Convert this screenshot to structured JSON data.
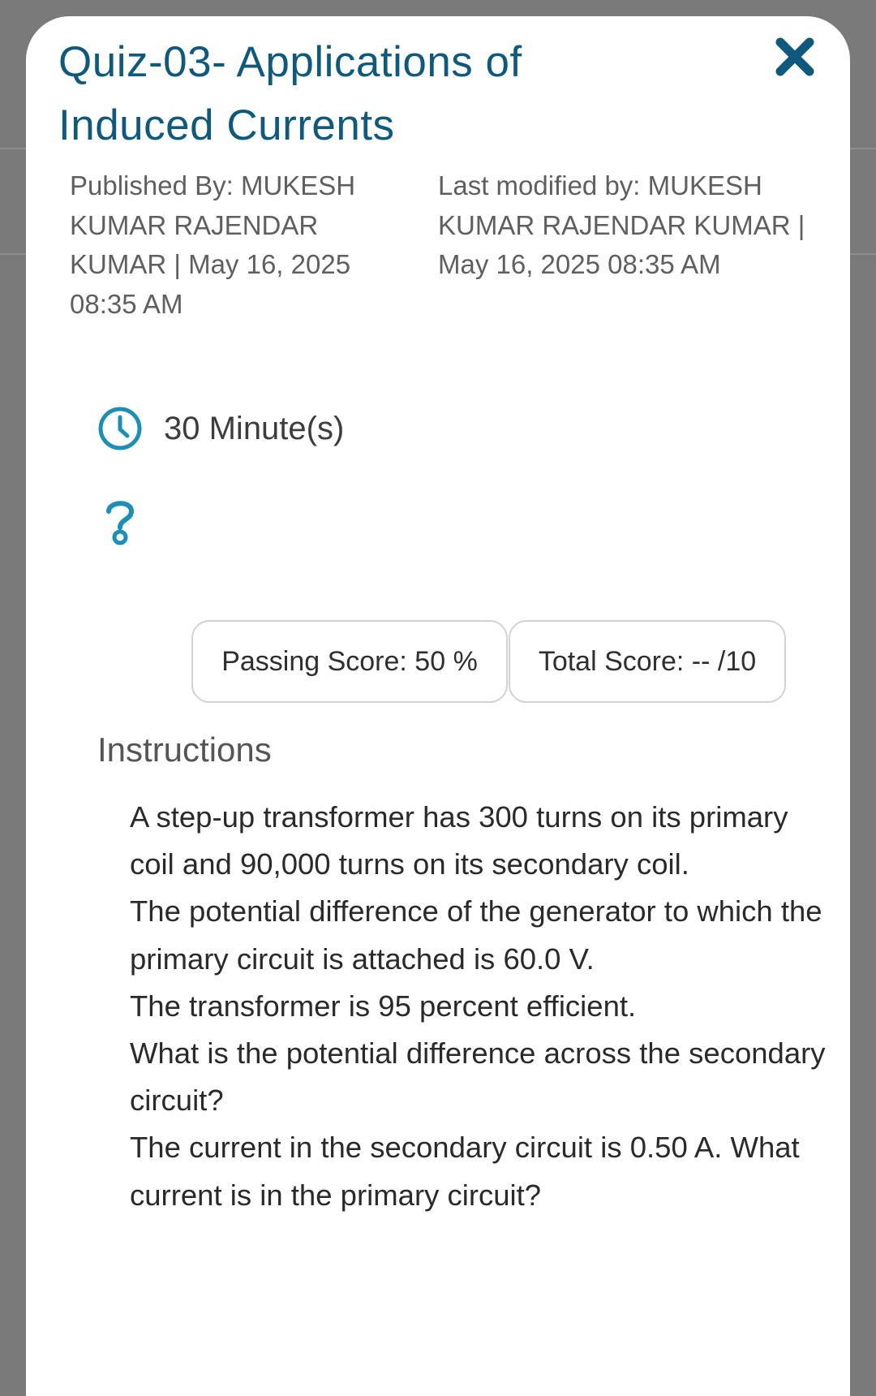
{
  "modal": {
    "title": "Quiz-03- Applications of Induced Currents",
    "close_icon": "close-icon"
  },
  "meta": {
    "published": "Published By:  MUKESH KUMAR RAJENDAR KUMAR | May 16, 2025 08:35 AM",
    "modified": "Last modified by: MUKESH KUMAR RAJENDAR KUMAR | May 16, 2025 08:35 AM"
  },
  "quiz": {
    "duration": "30 Minute(s)",
    "duration_icon": "clock-icon",
    "questions_icon": "question-icon",
    "passing_score": "Passing Score: 50 %",
    "total_score": "Total Score: -- /10"
  },
  "instructions": {
    "heading": "Instructions",
    "lines": [
      "A step-up transformer has 300 turns on its primary coil and 90,000 turns on its secondary coil.",
      "The potential difference of the generator to which the primary circuit is attached is 60.0 V.",
      "The transformer is 95 percent efficient.",
      "What is the potential difference across the secondary circuit?",
      "The current in the secondary circuit is 0.50 A. What current is in the primary circuit?"
    ]
  },
  "colors": {
    "title": "#0d5a7e",
    "accent_icon": "#1a8fb8",
    "overlay": "#7a7a7a"
  }
}
